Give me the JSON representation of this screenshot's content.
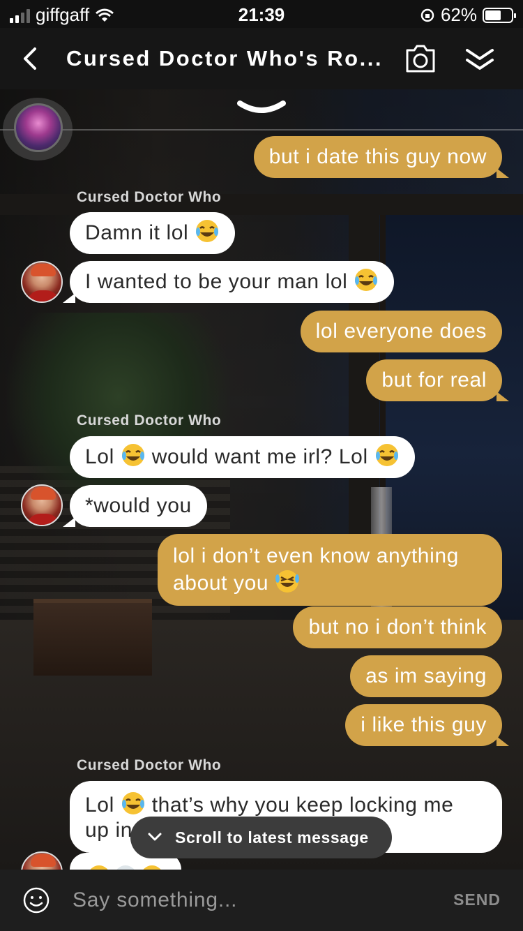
{
  "status_bar": {
    "carrier": "giffgaff",
    "time": "21:39",
    "battery": "62%",
    "battery_level": 0.62
  },
  "header": {
    "title": "Cursed Doctor Who's Ro...",
    "icons": [
      "chevron-left-icon",
      "camera-icon",
      "double-chevron-down-icon"
    ]
  },
  "messages": [
    {
      "dir": "out",
      "text": "but i date this guy now"
    },
    {
      "dir": "in",
      "sender": "Cursed Doctor Who",
      "text": "Damn it lol",
      "emoji": "laughing-tears"
    },
    {
      "dir": "in",
      "text": "I wanted to be your man lol",
      "emoji": "laughing-tears"
    },
    {
      "dir": "out",
      "text": "lol everyone does"
    },
    {
      "dir": "out",
      "text": "but for real"
    },
    {
      "dir": "in",
      "sender": "Cursed Doctor Who",
      "text_a": "Lol",
      "text_b": "would want me irl? Lol"
    },
    {
      "dir": "in",
      "text": "*would you"
    },
    {
      "dir": "out",
      "line1": "lol i don’t even know anything",
      "line2": "about you",
      "emoji": "rolling-laughing"
    },
    {
      "dir": "out",
      "text": "but no i don’t think"
    },
    {
      "dir": "out",
      "text": "as im saying"
    },
    {
      "dir": "out",
      "text": "i like this guy"
    },
    {
      "dir": "in",
      "sender": "Cursed Doctor Who",
      "text_a": "Lol",
      "text_b": "that’s why you keep locking me",
      "line2": "up in"
    }
  ],
  "scroll_pill": {
    "label": "Scroll to latest message"
  },
  "input": {
    "placeholder": "Say something...",
    "send_label": "SEND"
  },
  "colors": {
    "outgoing_bubble": "#d2a349",
    "incoming_bubble": "#ffffff",
    "background": "#141414"
  }
}
